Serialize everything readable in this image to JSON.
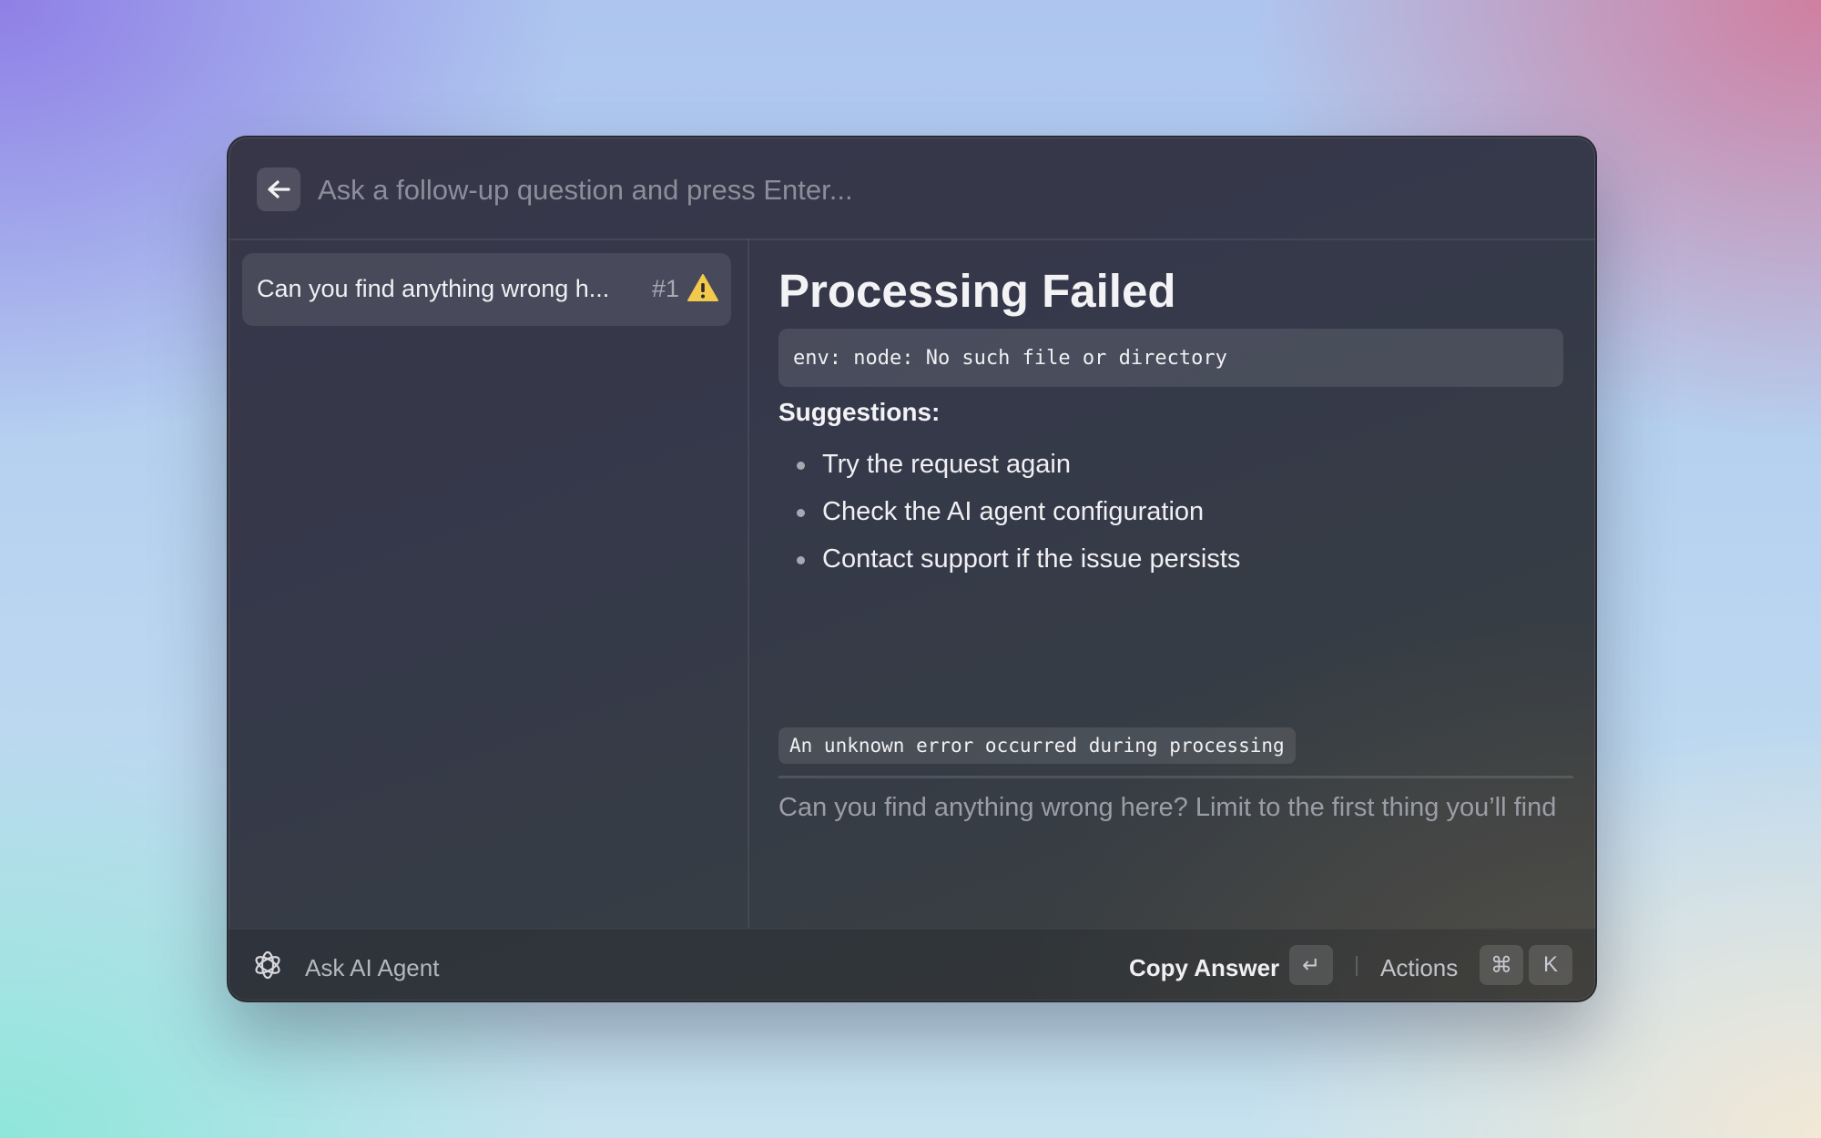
{
  "search": {
    "placeholder": "Ask a follow-up question and press Enter..."
  },
  "sidebar": {
    "items": [
      {
        "label": "Can you find anything wrong h...",
        "number": "#1",
        "icon": "warning-icon"
      }
    ]
  },
  "main": {
    "title": "Processing Failed",
    "error_code": "env: node: No such file or directory",
    "suggestions_heading": "Suggestions:",
    "suggestions": [
      "Try the request again",
      "Check the AI agent configuration",
      "Contact support if the issue persists"
    ],
    "error_detail": "An unknown error occurred during processing",
    "question": "Can you find anything wrong here? Limit to the first thing you’ll find"
  },
  "footer": {
    "agent_label": "Ask AI Agent",
    "copy_label": "Copy Answer",
    "copy_key": "↵",
    "actions_label": "Actions",
    "actions_keys": [
      "⌘",
      "K"
    ]
  },
  "colors": {
    "warning": "#f2c94c",
    "text": "#f0f0f3",
    "muted": "#9c9da6"
  }
}
